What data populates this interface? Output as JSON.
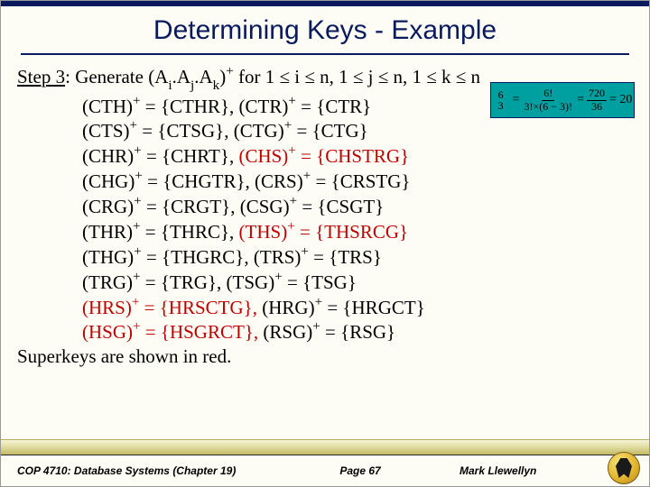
{
  "title": "Determining Keys - Example",
  "step": {
    "label": "Step 3",
    "text_before": "Generate (A",
    "sub1": "i",
    "mid1": ".A",
    "sub2": "j",
    "mid2": ".A",
    "sub3": "k",
    "text_after": ")",
    "plus": "+",
    "cond": " for 1 ≤ i ≤ n, 1 ≤ j ≤ n, 1 ≤ k ≤ n"
  },
  "lines": [
    {
      "a": "(CTH)",
      "ap": "+ ",
      "ae": "= {CTHR},   ",
      "b": "(CTR)",
      "bp": "+",
      "be": " = {CTR}",
      "aRed": false,
      "bRed": false
    },
    {
      "a": "(CTS)",
      "ap": "+",
      "ae": " = {CTSG}, ",
      "b": "(CTG)",
      "bp": "+",
      "be": " = {CTG}",
      "aRed": false,
      "bRed": false
    },
    {
      "a": "(CHR)",
      "ap": "+",
      "ae": " = {CHRT},   ",
      "b": "(CHS)",
      "bp": "+",
      "be": " = {CHSTRG}",
      "aRed": false,
      "bRed": true
    },
    {
      "a": "(CHG)",
      "ap": "+",
      "ae": " = {CHGTR}, ",
      "b": "(CRS)",
      "bp": "+",
      "be": " = {CRSTG}",
      "aRed": false,
      "bRed": false
    },
    {
      "a": "(CRG)",
      "ap": "+",
      "ae": " = {CRGT}, ",
      "b": "(CSG)",
      "bp": "+",
      "be": " = {CSGT}",
      "aRed": false,
      "bRed": false
    },
    {
      "a": "(THR)",
      "ap": "+",
      "ae": " = {THRC},   ",
      "b": "(THS)",
      "bp": "+",
      "be": " = {THSRCG}",
      "aRed": false,
      "bRed": true
    },
    {
      "a": "(THG)",
      "ap": "+",
      "ae": " = {THGRC}, ",
      "b": "(TRS)",
      "bp": "+",
      "be": " = {TRS}",
      "aRed": false,
      "bRed": false
    },
    {
      "a": "(TRG)",
      "ap": "+",
      "ae": " = {TRG},  ",
      "b": "(TSG)",
      "bp": "+",
      "be": " = {TSG}",
      "aRed": false,
      "bRed": false
    },
    {
      "a": "(HRS)",
      "ap": "+",
      "ae": " = {HRSCTG},   ",
      "b": "(HRG)",
      "bp": "+",
      "be": " = {HRGCT}",
      "aRed": true,
      "bRed": false
    },
    {
      "a": "(HSG)",
      "ap": "+",
      "ae": " = {HSGRCT},   ",
      "b": "(RSG)",
      "bp": "+",
      "be": " = {RSG}",
      "aRed": true,
      "bRed": false
    }
  ],
  "footnote": "Superkeys are shown in red.",
  "formula": {
    "top": "6",
    "bot": "3",
    "eq1": "=",
    "f1n": "6!",
    "f1d": "3!×(6 − 3)!",
    "eq2": "=",
    "f2n": "720",
    "f2d": "36",
    "eq3": "= 20"
  },
  "footer": {
    "course": "COP 4710: Database Systems  (Chapter 19)",
    "page": "Page 67",
    "author": "Mark Llewellyn"
  }
}
